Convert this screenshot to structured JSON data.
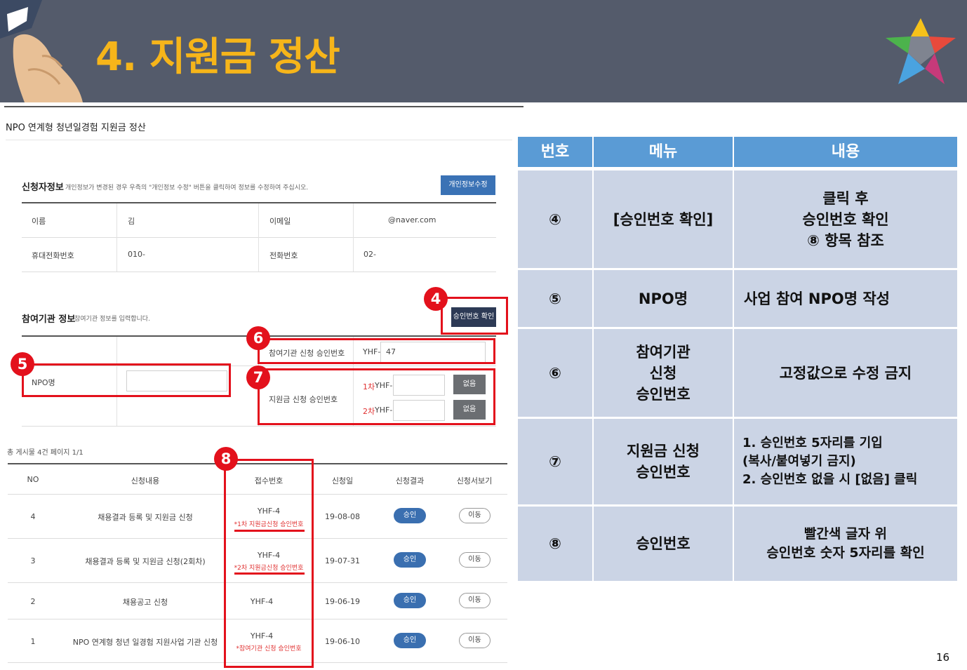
{
  "slide": {
    "title": "4. 지원금 정산",
    "page_number": "16",
    "header_bg": "#545b6b",
    "title_color": "#f6b51a",
    "accent_red": "#e3111c"
  },
  "screen": {
    "page_heading": "NPO 연계형 청년일경험 지원금 정산",
    "applicant": {
      "title": "신청자정보",
      "note": "개인정보가 변경된 경우 우측의 \"개인정보 수정\" 버튼을 클릭하여 정보를 수정하여 주십시오.",
      "edit_button": "개인정보수정",
      "name_label": "이름",
      "name_value": "김",
      "email_label": "이메일",
      "email_value": "@naver.com",
      "mobile_label": "휴대전화번호",
      "mobile_value": "010-",
      "phone_label": "전화번호",
      "phone_value": "02-"
    },
    "org": {
      "title": "참여기관 정보",
      "note": "참여기관 정보를 입력합니다.",
      "confirm_button": "승인번호 확인",
      "npo_label": "NPO명",
      "npo_value": "",
      "org_approval_label": "참여기관 신청 승인번호",
      "org_approval_prefix": "YHF-",
      "org_approval_value": "47",
      "grant_approval_label": "지원금 신청 승인번호",
      "first_label": "1차",
      "second_label": "2차",
      "prefix": "YHF-",
      "none_button": "없음"
    },
    "list": {
      "summary": "총 게시물 4건  페이지 1/1",
      "headers": [
        "NO",
        "신청내용",
        "접수번호",
        "신청일",
        "신청결과",
        "신청서보기"
      ],
      "rows": [
        {
          "no": "4",
          "content": "채용결과 등록 및 지원금 신청",
          "receipt": "YHF-4",
          "note": "*1차 지원금신청 승인번호",
          "date": "19-08-08",
          "result": "승인",
          "view": "이동"
        },
        {
          "no": "3",
          "content": "채용결과 등록 및 지원금 신청(2회차)",
          "receipt": "YHF-4",
          "note": "*2차 지원금신청 승인번호",
          "date": "19-07-31",
          "result": "승인",
          "view": "이동"
        },
        {
          "no": "2",
          "content": "채용공고 신청",
          "receipt": "YHF-4",
          "note": "",
          "date": "19-06-19",
          "result": "승인",
          "view": "이동"
        },
        {
          "no": "1",
          "content": "NPO 연계형 청년 일경험 지원사업 기관 신청",
          "receipt": "YHF-4",
          "note": "*참여기관 신청 승인번호",
          "date": "19-06-10",
          "result": "승인",
          "view": "이동"
        }
      ]
    },
    "markers": [
      "4",
      "5",
      "6",
      "7",
      "8"
    ]
  },
  "guide_table": {
    "headers": [
      "번호",
      "메뉴",
      "내용"
    ],
    "rows": [
      {
        "num": "④",
        "menu": "[승인번호 확인]",
        "content": "클릭 후\n승인번호 확인\n⑧ 항목 참조"
      },
      {
        "num": "⑤",
        "menu": "NPO명",
        "content": "사업 참여 NPO명 작성"
      },
      {
        "num": "⑥",
        "menu": "참여기관\n신청\n승인번호",
        "content": "고정값으로 수정 금지"
      },
      {
        "num": "⑦",
        "menu": "지원금 신청\n승인번호",
        "content": "1. 승인번호 5자리를 기입\n   (복사/붙여넣기 금지)\n2. 승인번호 없을 시 [없음] 클릭"
      },
      {
        "num": "⑧",
        "menu": "승인번호",
        "content": "빨간색 글자 위\n승인번호 숫자 5자리를 확인"
      }
    ],
    "header_color": "#5a9bd5",
    "cell_color": "#cbd4e5"
  }
}
